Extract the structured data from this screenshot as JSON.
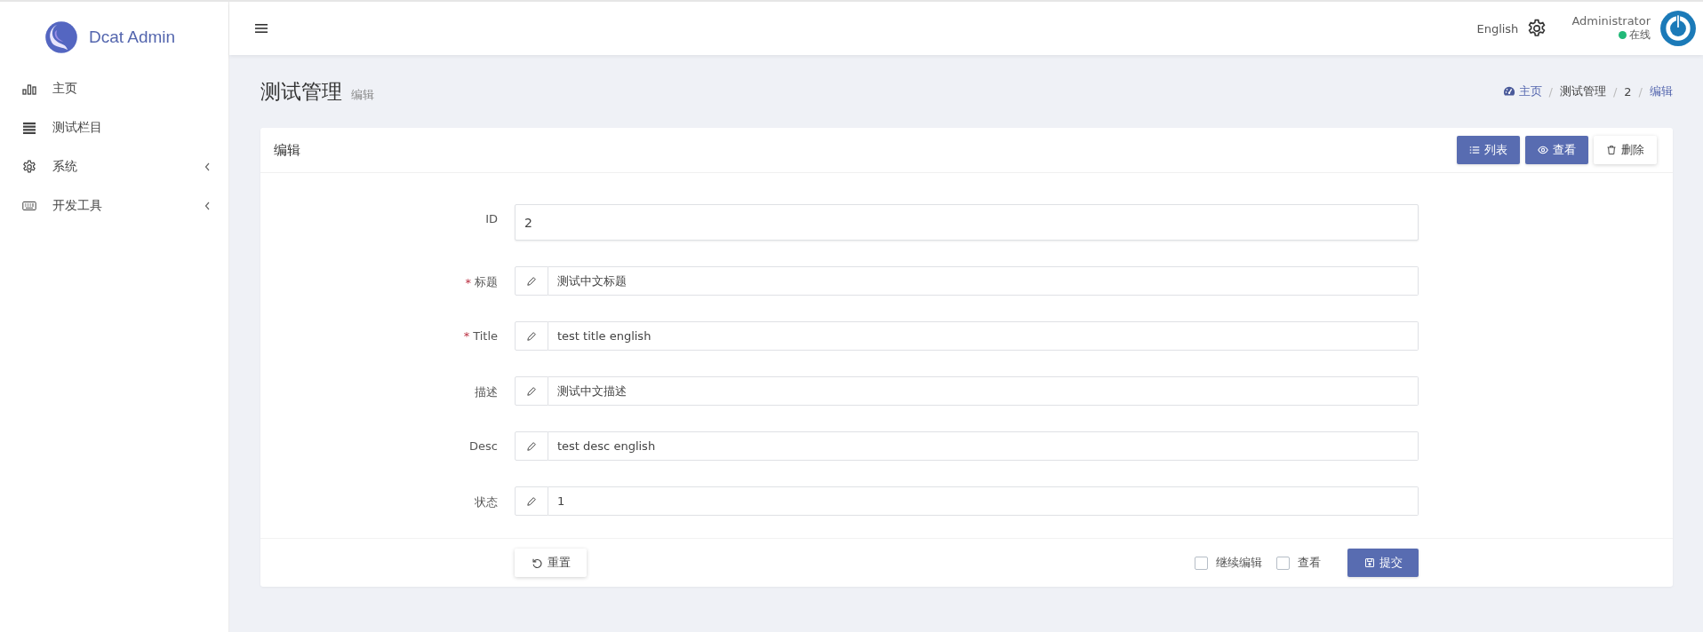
{
  "brand": {
    "name": "Dcat Admin"
  },
  "sidebar": {
    "items": [
      {
        "label": "主页",
        "has_children": false
      },
      {
        "label": "测试栏目",
        "has_children": false
      },
      {
        "label": "系统",
        "has_children": true
      },
      {
        "label": "开发工具",
        "has_children": true
      }
    ]
  },
  "header": {
    "language": "English",
    "user": {
      "name": "Administrator",
      "status": "在线"
    }
  },
  "page": {
    "title": "测试管理",
    "subtitle": "编辑"
  },
  "breadcrumb": [
    {
      "label": "主页",
      "link": true
    },
    {
      "separator": "/",
      "label": "测试管理",
      "link": false
    },
    {
      "separator": "/",
      "label": "2",
      "link": false
    },
    {
      "separator": "/",
      "label": "编辑",
      "link": true
    }
  ],
  "card": {
    "title": "编辑",
    "buttons": [
      {
        "label": "列表",
        "kind": "list"
      },
      {
        "label": "查看",
        "kind": "view"
      },
      {
        "label": "删除",
        "kind": "delete"
      }
    ]
  },
  "form": {
    "fields": [
      {
        "label": "ID",
        "value": "2",
        "kind": "plain"
      },
      {
        "required_mark": "*",
        "label": "标题",
        "value": "测试中文标题",
        "kind": "icon"
      },
      {
        "required_mark": "*",
        "label": "Title",
        "value": "test title english",
        "kind": "icon"
      },
      {
        "label": "描述",
        "value": "测试中文描述",
        "kind": "icon"
      },
      {
        "label": "Desc",
        "value": "test desc english",
        "kind": "icon"
      },
      {
        "label": "状态",
        "value": "1",
        "kind": "icon"
      }
    ]
  },
  "footer": {
    "reset": "重置",
    "checkboxes": [
      {
        "label": "继续编辑",
        "checked": false
      },
      {
        "label": "查看",
        "checked": false
      }
    ],
    "submit": "提交"
  }
}
